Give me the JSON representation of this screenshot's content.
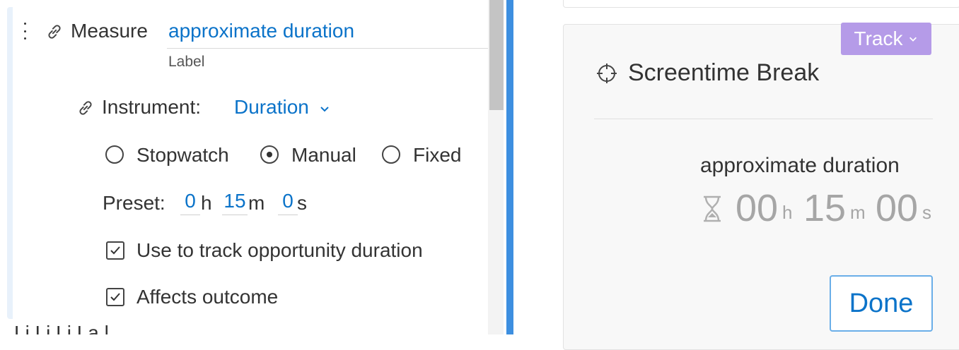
{
  "editor": {
    "measure_prefix": "Measure",
    "measure_value": "approximate duration",
    "label_caption": "Label",
    "instrument_label": "Instrument:",
    "instrument_value": "Duration",
    "modes": [
      {
        "label": "Stopwatch",
        "selected": false
      },
      {
        "label": "Manual",
        "selected": true
      },
      {
        "label": "Fixed",
        "selected": false
      }
    ],
    "preset": {
      "label": "Preset:",
      "hours": "0",
      "hours_unit": "h",
      "minutes": "15",
      "minutes_unit": "m",
      "seconds": "0",
      "seconds_unit": "s"
    },
    "checkboxes": [
      {
        "label": "Use to track opportunity duration",
        "checked": true
      },
      {
        "label": "Affects outcome",
        "checked": true
      }
    ],
    "partial_next_label": "Li Li  Li  La  l"
  },
  "preview": {
    "track_button_label": "Track",
    "title": "Screentime Break",
    "measure_name": "approximate duration",
    "hours": "00",
    "hours_unit": "h",
    "minutes": "15",
    "minutes_unit": "m",
    "seconds": "00",
    "seconds_unit": "s",
    "done_label": "Done"
  },
  "colors": {
    "accent_blue": "#0b73c9",
    "divider_blue": "#3d8fe0",
    "track_purple": "#b59be8"
  }
}
